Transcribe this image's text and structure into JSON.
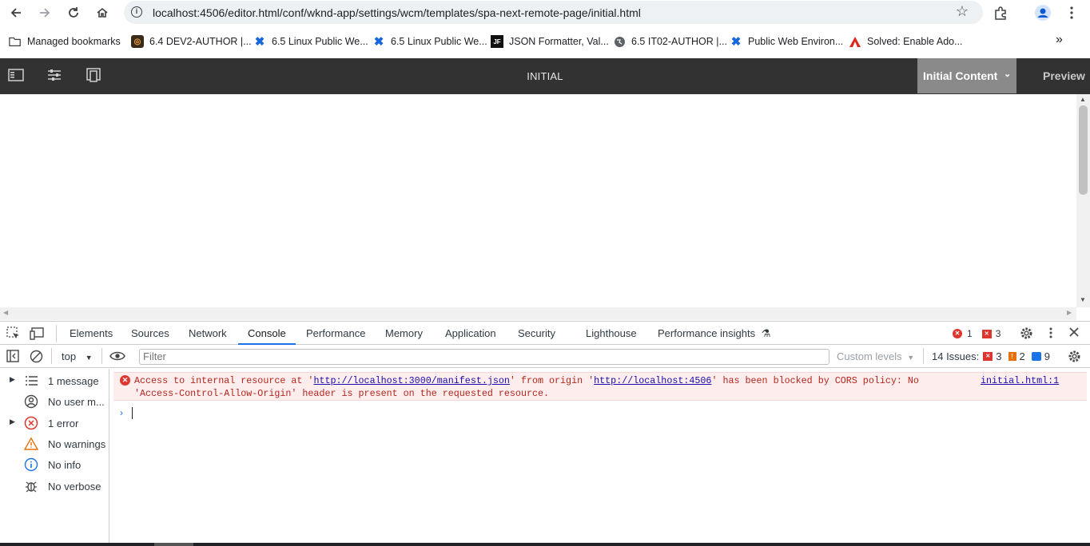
{
  "browser": {
    "url": "localhost:4506/editor.html/conf/wknd-app/settings/wcm/templates/spa-next-remote-page/initial.html",
    "bookmarks": [
      {
        "label": "Managed bookmarks",
        "icon": "folder-managed-icon"
      },
      {
        "label": "6.4 DEV2-AUTHOR |...",
        "icon": "aem-icon"
      },
      {
        "label": "6.5 Linux Public We...",
        "icon": "confluence-icon"
      },
      {
        "label": "6.5 Linux Public We...",
        "icon": "confluence-icon"
      },
      {
        "label": "JSON Formatter, Val...",
        "icon": "jf-icon",
        "icon_text": "JF"
      },
      {
        "label": "6.5 IT02-AUTHOR |...",
        "icon": "globe-icon"
      },
      {
        "label": "Public Web Environ...",
        "icon": "confluence-icon"
      },
      {
        "label": "Solved: Enable Ado...",
        "icon": "adobe-icon"
      }
    ],
    "more_bookmarks": "»"
  },
  "editor": {
    "title": "INITIAL",
    "mode_label": "Initial Content",
    "preview_label": "Preview"
  },
  "devtools": {
    "tabs": [
      "Elements",
      "Sources",
      "Network",
      "Console",
      "Performance",
      "Memory",
      "Application",
      "Security",
      "Lighthouse",
      "Performance insights"
    ],
    "active_tab": "Console",
    "error_count": "1",
    "warning_count": "3",
    "context": "top",
    "filter_placeholder": "Filter",
    "custom_levels": "Custom levels",
    "issues_label": "14 Issues:",
    "issues_errors": "3",
    "issues_warnings": "2",
    "issues_info": "9",
    "sidebar": [
      {
        "label": "1 message",
        "icon": "list-icon",
        "expandable": true
      },
      {
        "label": "No user m...",
        "icon": "user-icon",
        "expandable": false
      },
      {
        "label": "1 error",
        "icon": "error-icon",
        "expandable": true
      },
      {
        "label": "No warnings",
        "icon": "warning-icon",
        "expandable": false
      },
      {
        "label": "No info",
        "icon": "info-icon",
        "expandable": false
      },
      {
        "label": "No verbose",
        "icon": "bug-icon",
        "expandable": false
      }
    ],
    "error": {
      "pre": "Access to internal resource at '",
      "link1": "http://localhost:3000/manifest.json",
      "mid": "' from origin '",
      "link2": "http://localhost:4506",
      "post": "' has been blocked by CORS policy: No",
      "line2": "'Access-Control-Allow-Origin' header is present on the requested resource.",
      "source": "initial.html:1"
    },
    "prompt": "›"
  },
  "colors": {
    "aem_header": "#323232",
    "active_tab": "#1a73e8",
    "error_bg": "#fdeded",
    "error_text": "#b3261e"
  }
}
